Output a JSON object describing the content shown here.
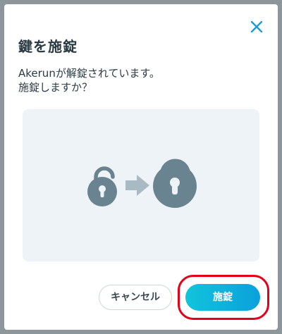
{
  "dialog": {
    "title": "鍵を施錠",
    "message_line1": "Akerunが解錠されています。",
    "message_line2": "施錠しますか？",
    "close_icon": "close-icon",
    "illustration": {
      "from_icon": "unlocked-padlock-icon",
      "arrow_icon": "arrow-right-icon",
      "to_icon": "locked-padlock-icon",
      "icon_color": "#6a8390",
      "arrow_color": "#a9bac4",
      "background_color": "#eef3f8"
    },
    "buttons": {
      "cancel_label": "キャンセル",
      "lock_label": "施錠"
    },
    "colors": {
      "accent_start": "#11c4dc",
      "accent_end": "#0aa0dc",
      "highlight": "#e3001b",
      "close_icon": "#1a9bd6"
    }
  }
}
